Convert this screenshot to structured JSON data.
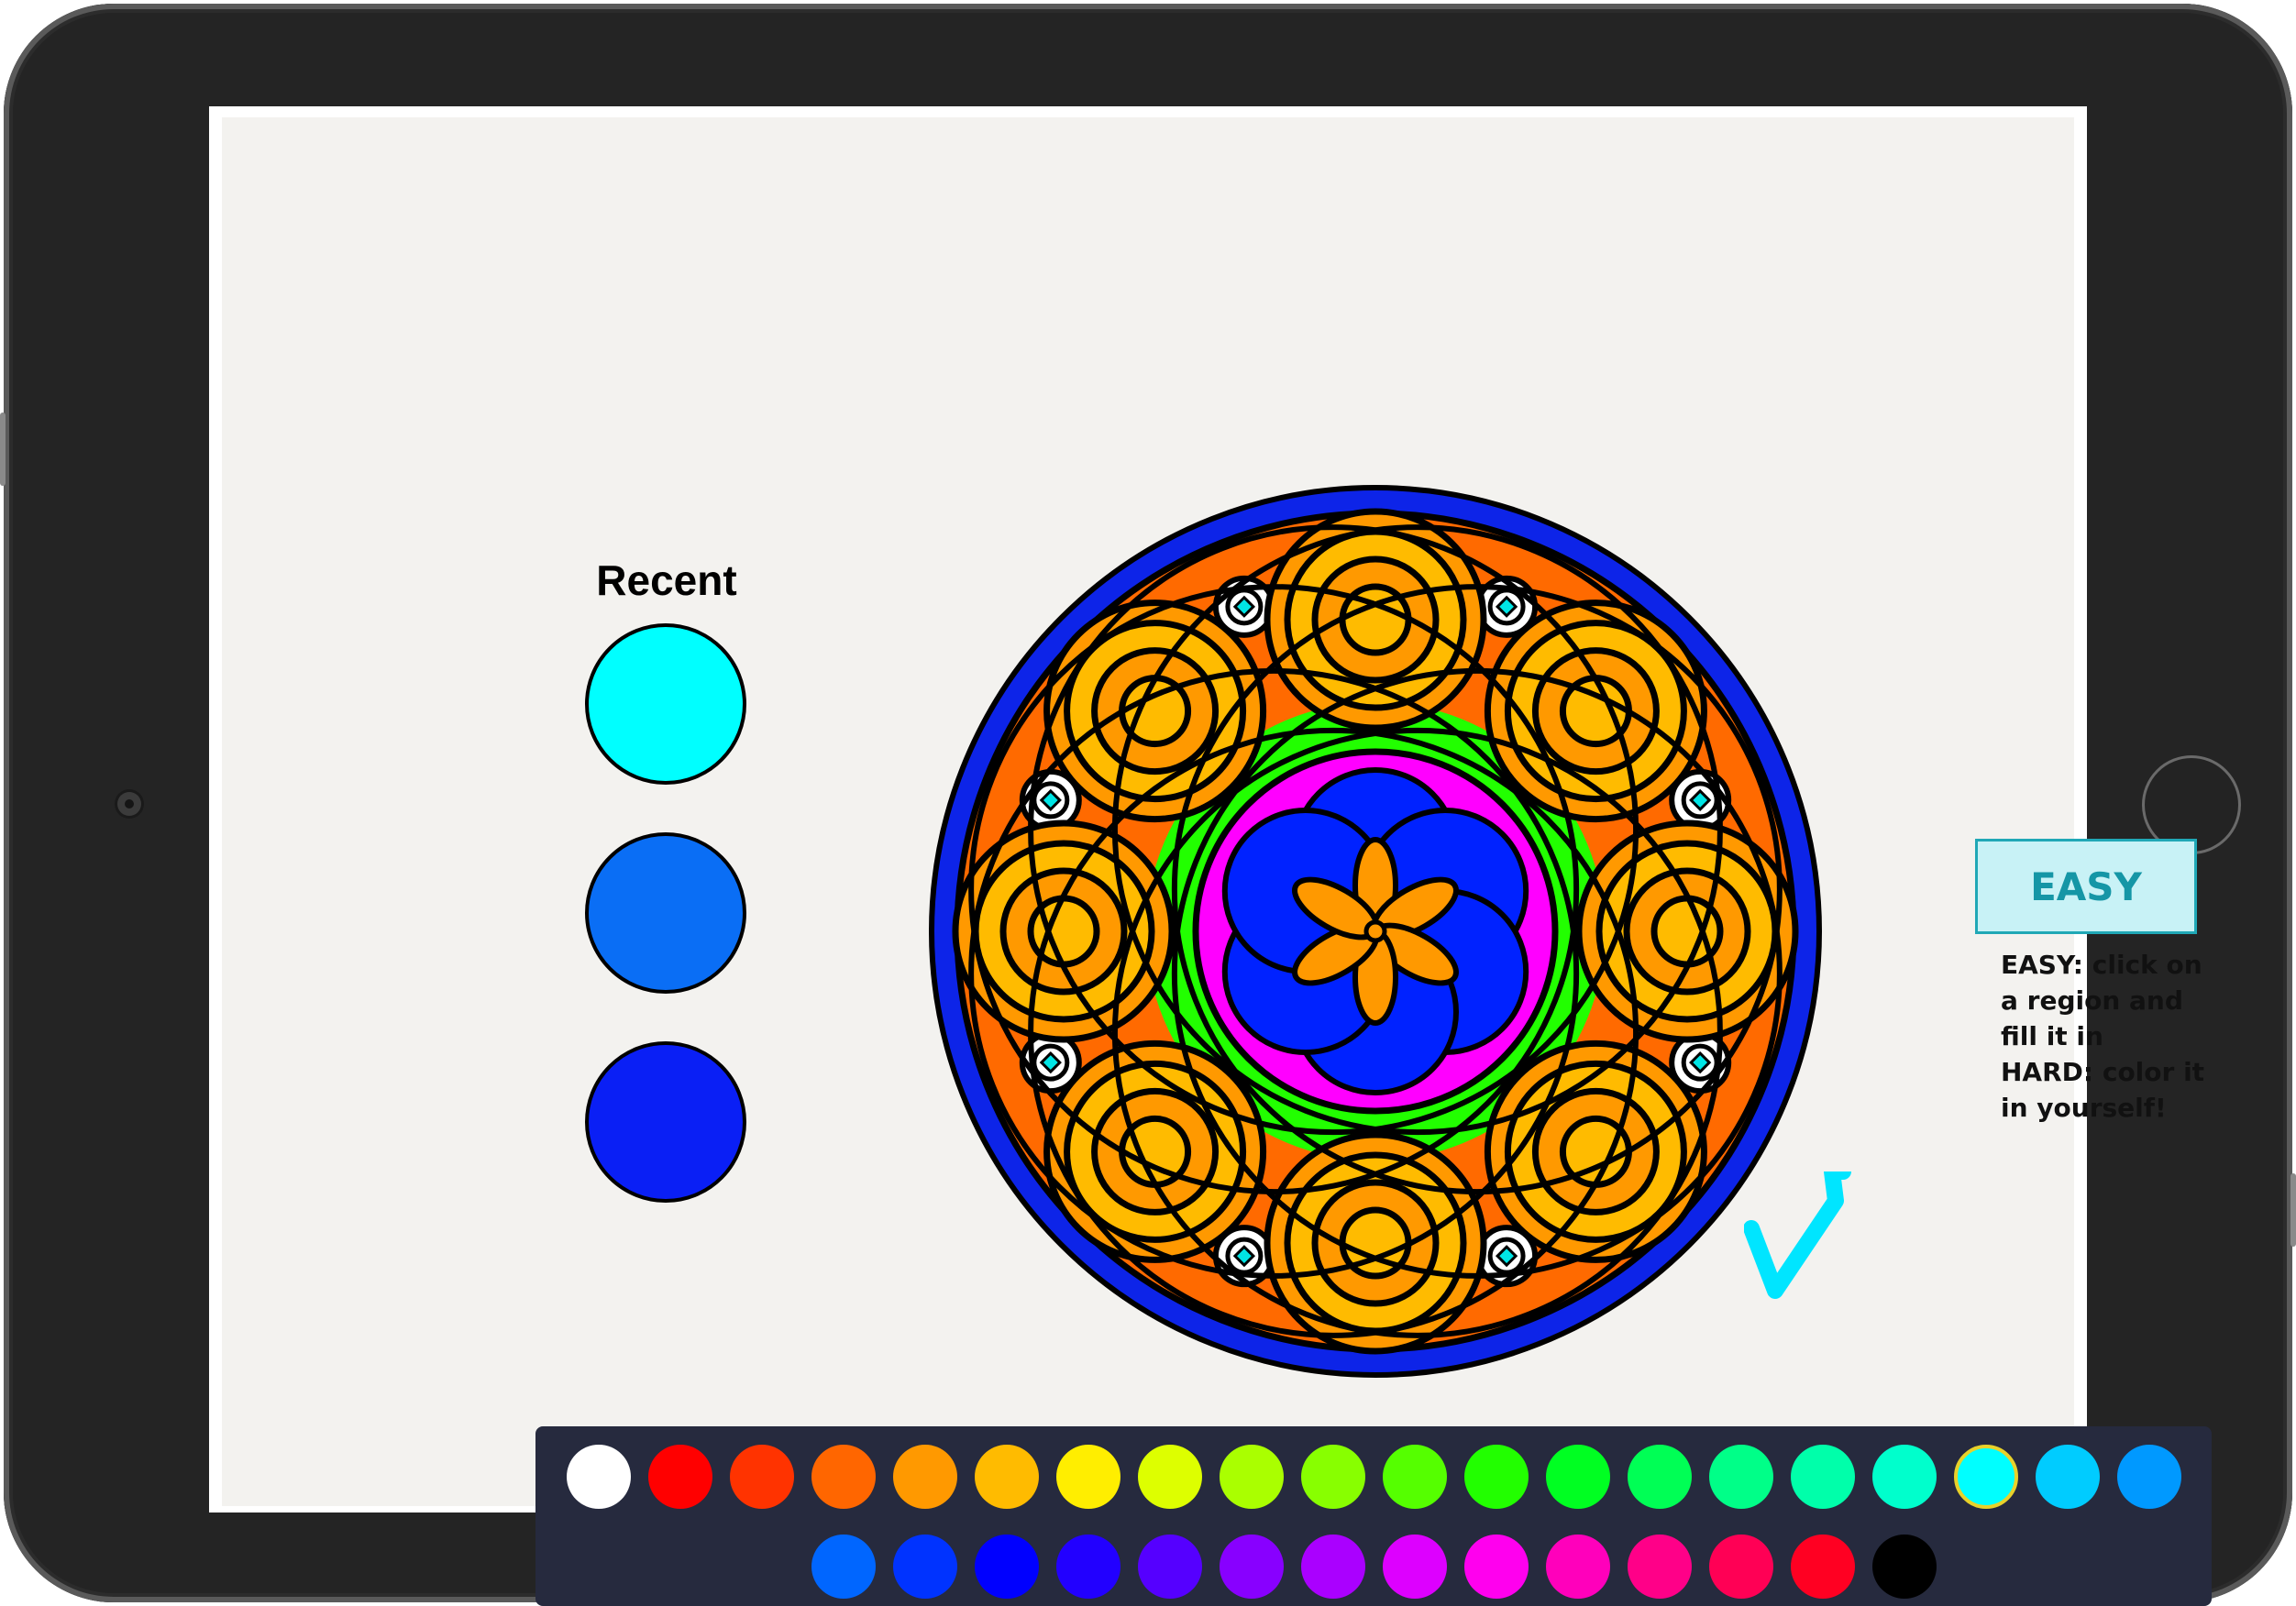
{
  "app": {
    "recent_title": "Recent",
    "recent_colors": [
      "#00ffff",
      "#0a6ef5",
      "#0a1ff5"
    ],
    "mode_button_label": "EASY",
    "mode_help_lines": [
      "EASY: click on",
      "a region and",
      "fill it in",
      "HARD: color it",
      "in yourself!"
    ]
  },
  "palette": {
    "row1": [
      "#ffffff",
      "#ff0000",
      "#ff3300",
      "#ff6600",
      "#ff9900",
      "#ffbb00",
      "#ffee00",
      "#ddff00",
      "#aaff00",
      "#88ff00",
      "#55ff00",
      "#22ff00",
      "#00ff22",
      "#00ff55",
      "#00ff88",
      "#00ffaa",
      "#00ffcc",
      "#00ffff",
      "#00ccff",
      "#0099ff"
    ],
    "row2": [
      "#0066ff",
      "#0033ff",
      "#0000ff",
      "#2200ff",
      "#5500ff",
      "#8800ff",
      "#aa00ff",
      "#dd00ff",
      "#ff00ee",
      "#ff00bb",
      "#ff0088",
      "#ff0055",
      "#ff0022",
      "#000000"
    ],
    "selected_color": "#00ffff"
  },
  "mandala_colors": {
    "outer_ring": "#0d24e8",
    "outer_field": "#ff6a00",
    "rings_outer": "#ff9900",
    "rings_inner": "#ffbb00",
    "triangles": "#22ff00",
    "center_disk": "#ff00ff",
    "petals_blue": "#0022ff",
    "petals_orange": "#ff9900",
    "dot_accent": "#00e5e5"
  },
  "check_color": "#00e5ff"
}
